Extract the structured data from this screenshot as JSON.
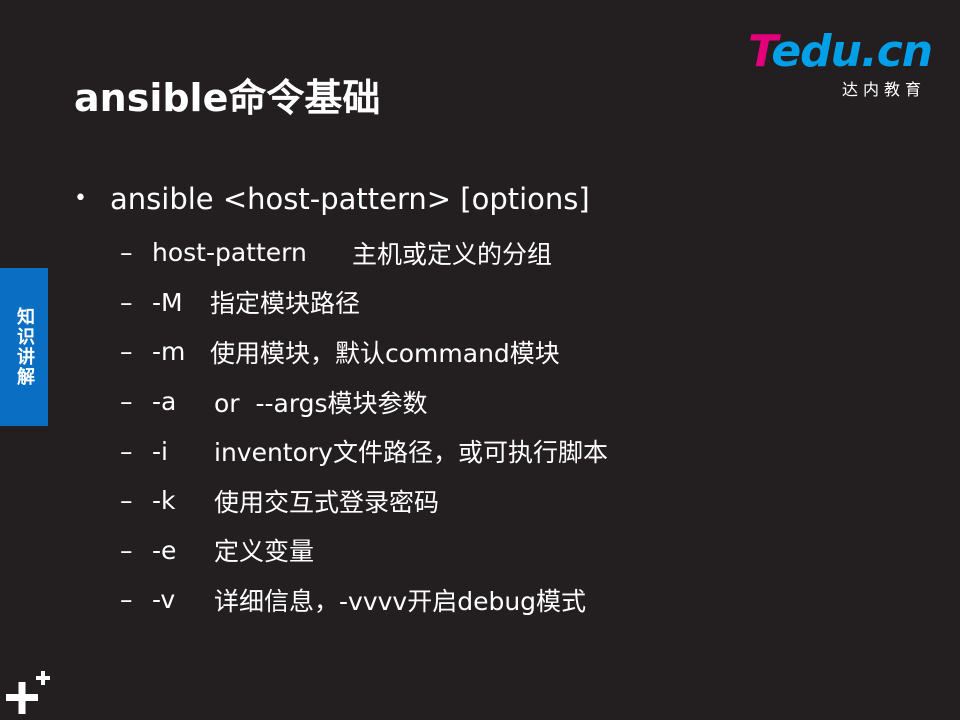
{
  "logo": {
    "brand_t": "T",
    "brand_rest": "edu.cn",
    "subtitle": "达内教育",
    "colors": {
      "t": "#e3007b",
      "rest": "#00a0e9"
    }
  },
  "title": "ansible命令基础",
  "side_tab": {
    "label": "知识讲解",
    "color": "#0a6fc2"
  },
  "main_bullet": {
    "marker": "•",
    "text": "ansible <host-pattern> [options]"
  },
  "sub_items": [
    {
      "marker": "–",
      "option": "host-pattern",
      "description": "主机或定义的分组"
    },
    {
      "marker": "–",
      "option": "-M",
      "description": "指定模块路径"
    },
    {
      "marker": "–",
      "option": "-m",
      "description": "使用模块，默认command模块"
    },
    {
      "marker": "–",
      "option": "-a",
      "description": "or  --args模块参数"
    },
    {
      "marker": "–",
      "option": "-i",
      "description": "inventory文件路径，或可执行脚本"
    },
    {
      "marker": "–",
      "option": "-k",
      "description": "使用交互式登录密码"
    },
    {
      "marker": "–",
      "option": "-e",
      "description": "定义变量"
    },
    {
      "marker": "–",
      "option": "-v",
      "description": "详细信息，-vvvv开启debug模式"
    }
  ],
  "icons": {
    "bottom_left": "plus-icon"
  },
  "background_color": "#231f20"
}
